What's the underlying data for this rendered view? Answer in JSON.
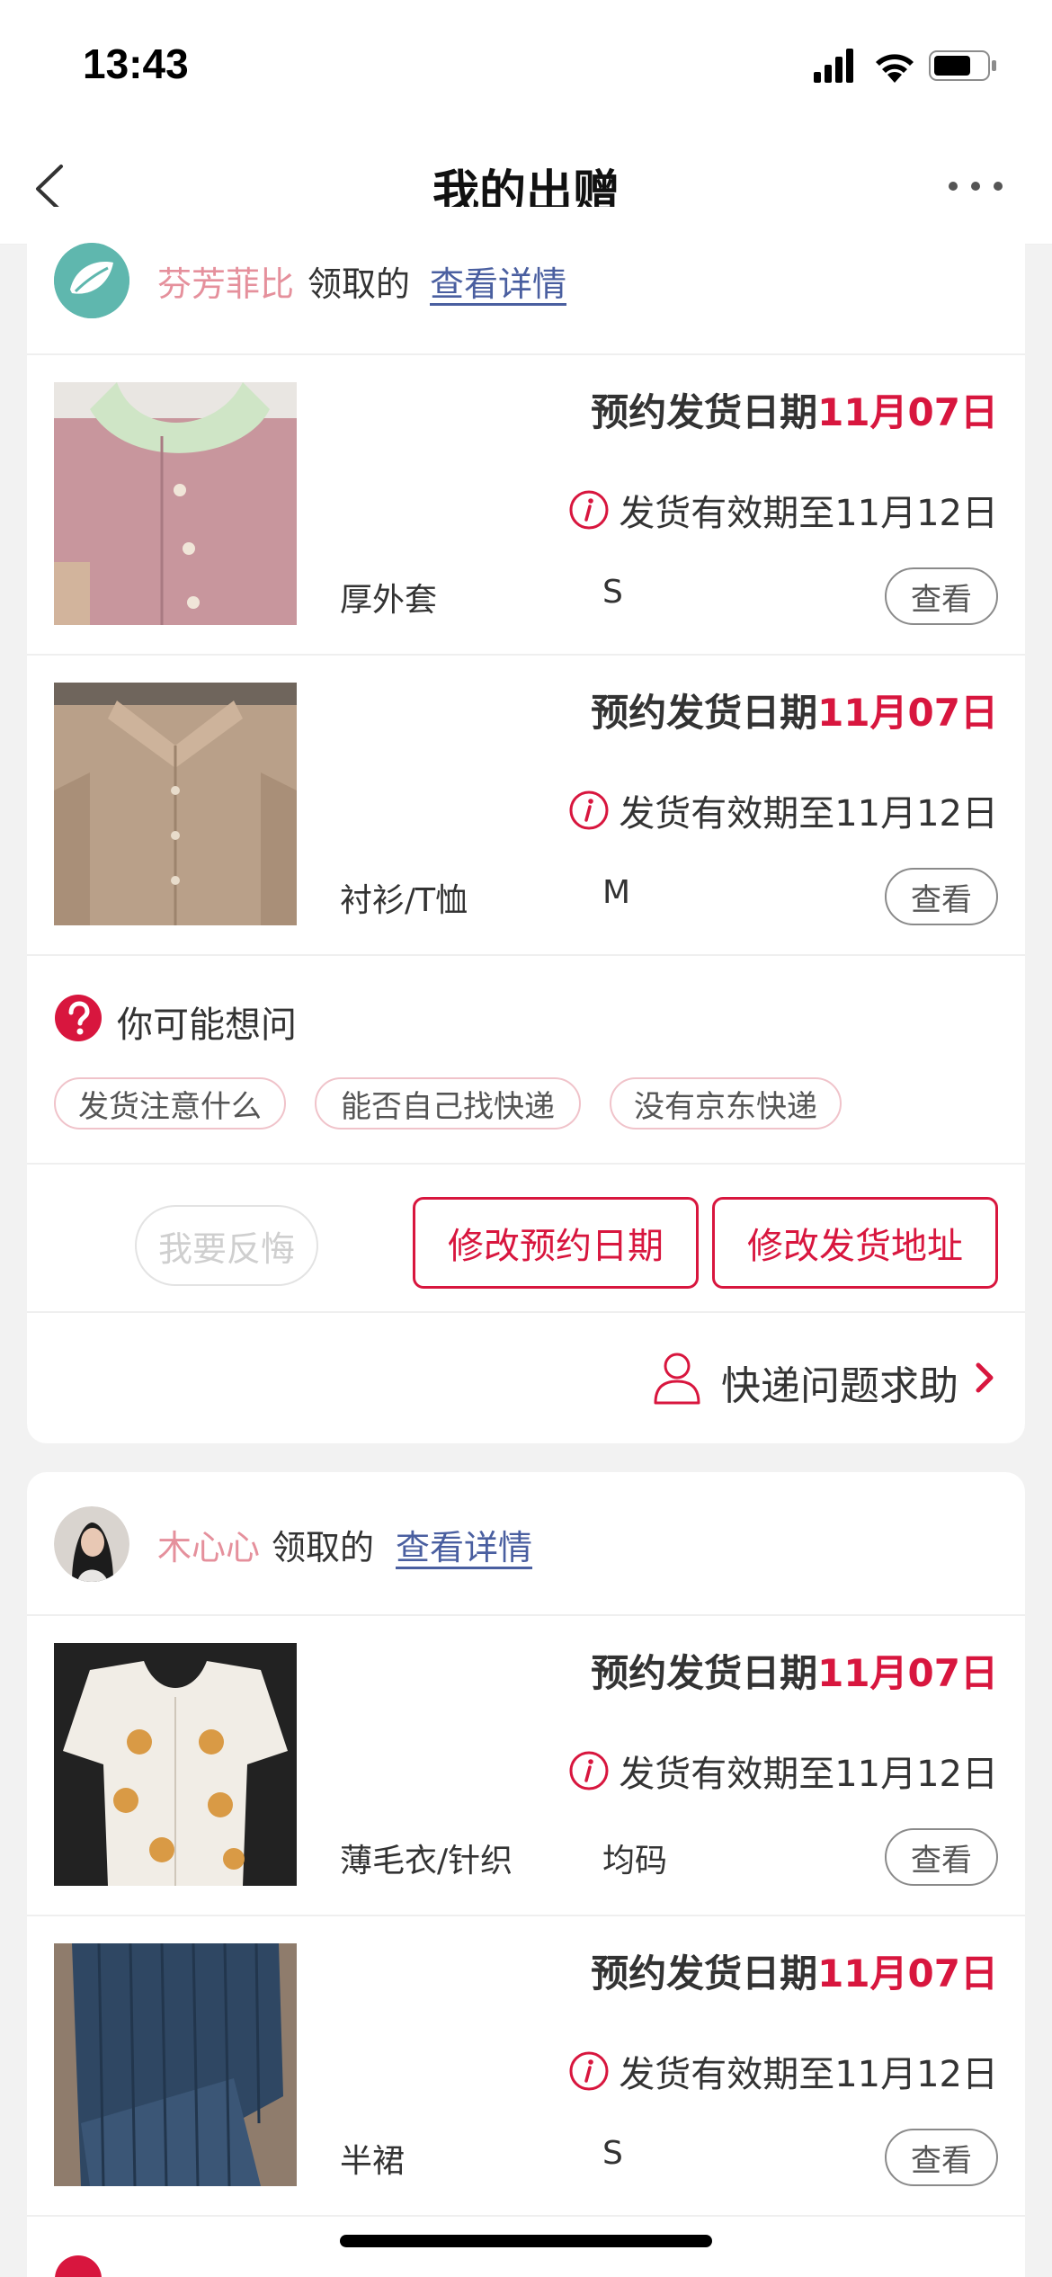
{
  "status_bar": {
    "time": "13:43"
  },
  "nav": {
    "title": "我的出赠"
  },
  "orders": [
    {
      "receiver": {
        "name": "芬芳菲比",
        "suffix": "领取的",
        "link": "查看详情"
      },
      "items": [
        {
          "date_label": "预约发货日期",
          "date": "11月07日",
          "validity": "发货有效期至11月12日",
          "category": "厚外套",
          "size": "S",
          "view": "查看"
        },
        {
          "date_label": "预约发货日期",
          "date": "11月07日",
          "validity": "发货有效期至11月12日",
          "category": "衬衫/T恤",
          "size": "M",
          "view": "查看"
        }
      ],
      "faq": {
        "title": "你可能想问",
        "chips": [
          "发货注意什么",
          "能否自己找快递",
          "没有京东快递"
        ]
      },
      "actions": {
        "regret": "我要反悔",
        "change_date": "修改预约日期",
        "change_address": "修改发货地址"
      },
      "help": "快递问题求助"
    },
    {
      "receiver": {
        "name": "木心心",
        "suffix": "领取的",
        "link": "查看详情"
      },
      "items": [
        {
          "date_label": "预约发货日期",
          "date": "11月07日",
          "validity": "发货有效期至11月12日",
          "category": "薄毛衣/针织",
          "size": "均码",
          "view": "查看"
        },
        {
          "date_label": "预约发货日期",
          "date": "11月07日",
          "validity": "发货有效期至11月12日",
          "category": "半裙",
          "size": "S",
          "view": "查看"
        }
      ]
    }
  ],
  "colors": {
    "accent": "#d8163e",
    "name_pink": "#e5909c",
    "link_blue": "#4a5fa0"
  },
  "icons": [
    "signal-icon",
    "wifi-icon",
    "battery-icon",
    "back-chevron-icon",
    "more-dots-icon",
    "info-icon",
    "question-icon",
    "person-icon",
    "chevron-right-icon"
  ]
}
